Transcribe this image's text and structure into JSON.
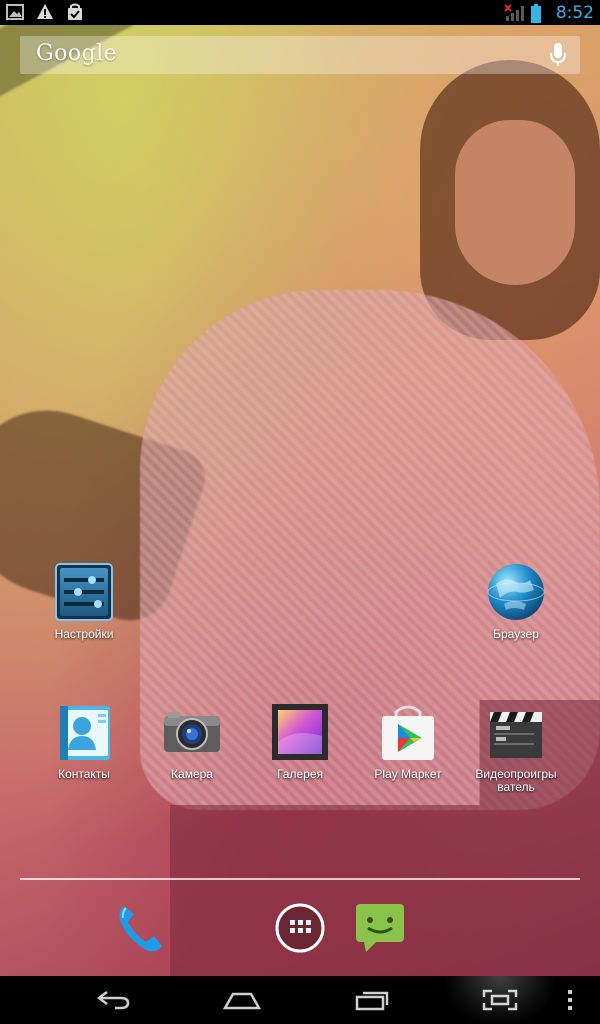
{
  "status_bar": {
    "time": "8:52",
    "notification_icons": [
      "image-icon",
      "warning-icon",
      "shopping-bag-icon"
    ],
    "system_icons": [
      "signal-icon",
      "battery-icon"
    ]
  },
  "search": {
    "logo": "Google",
    "mic_icon": "microphone-icon"
  },
  "apps": {
    "settings": {
      "label": "Настройки",
      "icon": "settings-icon"
    },
    "browser": {
      "label": "Браузер",
      "icon": "globe-icon"
    },
    "contacts": {
      "label": "Контакты",
      "icon": "contacts-icon"
    },
    "camera": {
      "label": "Камера",
      "icon": "camera-icon"
    },
    "gallery": {
      "label": "Галерея",
      "icon": "gallery-icon"
    },
    "play_market": {
      "label": "Play Маркет",
      "icon": "play-store-icon"
    },
    "video_player": {
      "label": "Видеопроигры ватель",
      "icon": "clapperboard-icon"
    }
  },
  "dock": {
    "items": [
      "phone-icon",
      "app-drawer-icon",
      "messaging-icon"
    ]
  },
  "nav_bar": {
    "items": [
      "back-icon",
      "home-icon",
      "recent-apps-icon",
      "screenshot-icon",
      "menu-icon"
    ]
  },
  "colors": {
    "status_accent": "#33b5e5",
    "label_text": "#ffffff",
    "nav_icons": "#cfcfcf"
  }
}
